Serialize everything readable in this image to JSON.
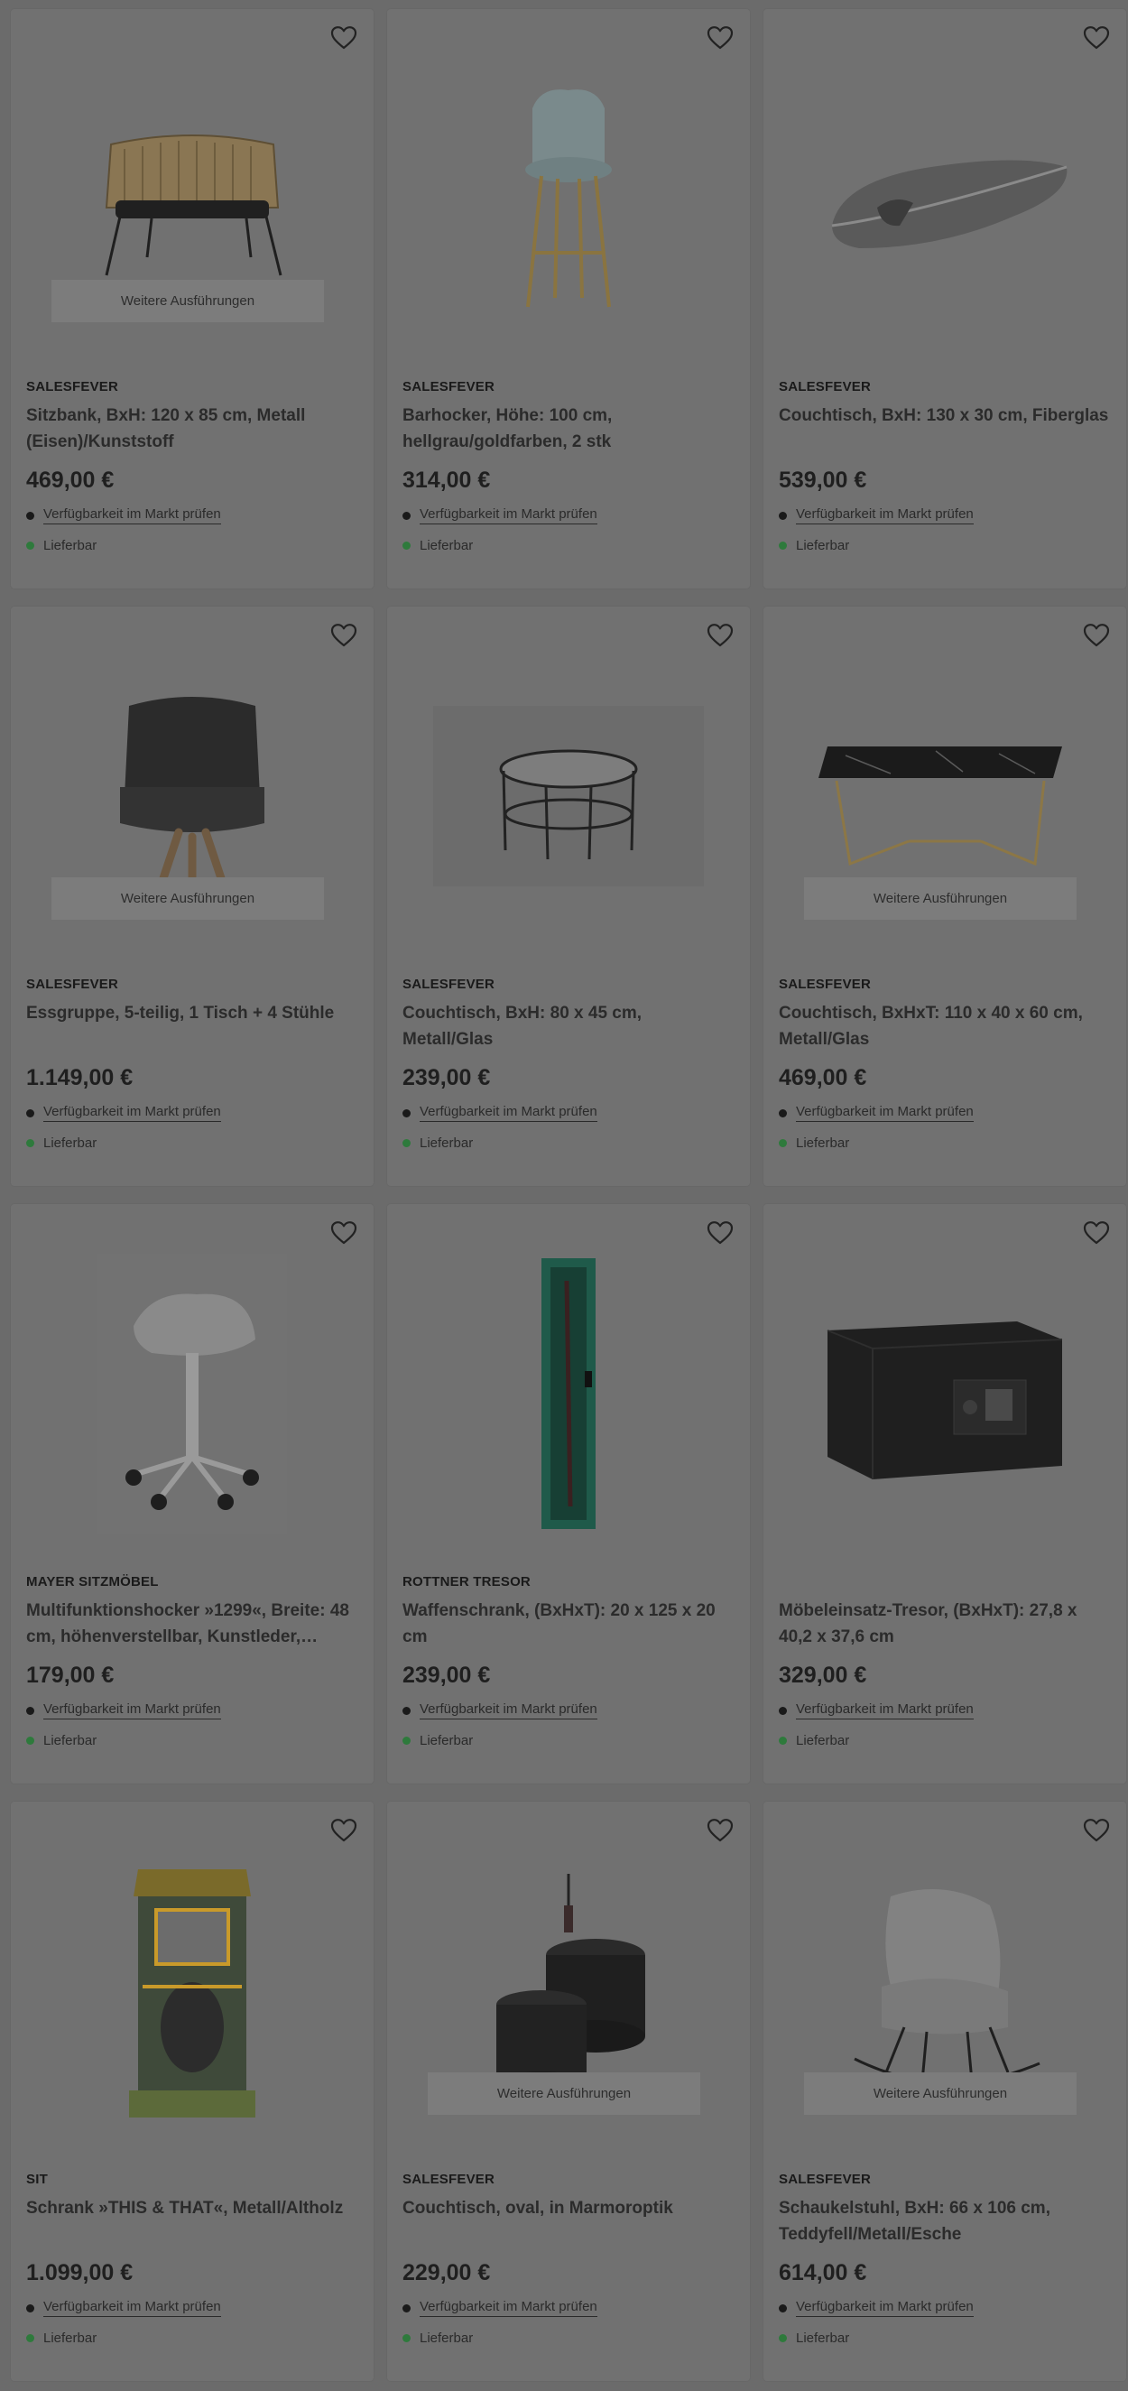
{
  "accent_colors": {
    "available_dot": "#2e7a3c",
    "check_dot": "#1a1a1a"
  },
  "products": [
    {
      "brand": "SALESFEVER",
      "title": "Sitzbank, BxH: 120 x 85 cm, Metall (Eisen)/Kunststoff",
      "price": "469,00 €",
      "check": "Verfügbarkeit im Markt prüfen",
      "availability": "Lieferbar",
      "variants": "Weitere Ausführungen",
      "icon": "bench-image"
    },
    {
      "brand": "SALESFEVER",
      "title": "Barhocker, Höhe: 100 cm, hellgrau/goldfarben, 2 stk",
      "price": "314,00 €",
      "check": "Verfügbarkeit im Markt prüfen",
      "availability": "Lieferbar",
      "variants": "",
      "icon": "barstool-image"
    },
    {
      "brand": "SALESFEVER",
      "title": "Couchtisch, BxH: 130 x 30 cm, Fiberglas",
      "price": "539,00 €",
      "check": "Verfügbarkeit im Markt prüfen",
      "availability": "Lieferbar",
      "variants": "",
      "icon": "fiberglass-table-image"
    },
    {
      "brand": "SALESFEVER",
      "title": "Essgruppe, 5-teilig, 1 Tisch + 4 Stühle",
      "price": "1.149,00 €",
      "check": "Verfügbarkeit im Markt prüfen",
      "availability": "Lieferbar",
      "variants": "Weitere Ausführungen",
      "icon": "armchair-image"
    },
    {
      "brand": "SALESFEVER",
      "title": "Couchtisch, BxH: 80 x 45 cm, Metall/Glas",
      "price": "239,00 €",
      "check": "Verfügbarkeit im Markt prüfen",
      "availability": "Lieferbar",
      "variants": "",
      "icon": "round-table-image"
    },
    {
      "brand": "SALESFEVER",
      "title": "Couchtisch, BxHxT: 110 x 40 x 60 cm, Metall/Glas",
      "price": "469,00 €",
      "check": "Verfügbarkeit im Markt prüfen",
      "availability": "Lieferbar",
      "variants": "Weitere Ausführungen",
      "icon": "marble-table-image"
    },
    {
      "brand": "MAYER SITZMÖBEL",
      "title": "Multifunktionshocker »1299«, Breite: 48 cm, höhenverstellbar, Kunstleder,…",
      "price": "179,00 €",
      "check": "Verfügbarkeit im Markt prüfen",
      "availability": "Lieferbar",
      "variants": "",
      "icon": "stool-image"
    },
    {
      "brand": "ROTTNER TRESOR",
      "title": "Waffenschrank, (BxHxT): 20 x 125 x 20 cm",
      "price": "239,00 €",
      "check": "Verfügbarkeit im Markt prüfen",
      "availability": "Lieferbar",
      "variants": "",
      "icon": "gun-cabinet-image"
    },
    {
      "brand": "",
      "title": "Möbeleinsatz-Tresor, (BxHxT): 27,8 x 40,2 x 37,6 cm",
      "price": "329,00 €",
      "check": "Verfügbarkeit im Markt prüfen",
      "availability": "Lieferbar",
      "variants": "",
      "icon": "safe-image"
    },
    {
      "brand": "SIT",
      "title": "Schrank »THIS & THAT«, Metall/Altholz",
      "price": "1.099,00 €",
      "check": "Verfügbarkeit im Markt prüfen",
      "availability": "Lieferbar",
      "variants": "",
      "icon": "cabinet-image"
    },
    {
      "brand": "SALESFEVER",
      "title": "Couchtisch, oval, in Marmoroptik",
      "price": "229,00 €",
      "check": "Verfügbarkeit im Markt prüfen",
      "availability": "Lieferbar",
      "variants": "Weitere Ausführungen",
      "icon": "oval-tables-image"
    },
    {
      "brand": "SALESFEVER",
      "title": "Schaukelstuhl, BxH: 66 x 106 cm, Teddyfell/Metall/Esche",
      "price": "614,00 €",
      "check": "Verfügbarkeit im Markt prüfen",
      "availability": "Lieferbar",
      "variants": "Weitere Ausführungen",
      "icon": "rocking-chair-image"
    }
  ]
}
